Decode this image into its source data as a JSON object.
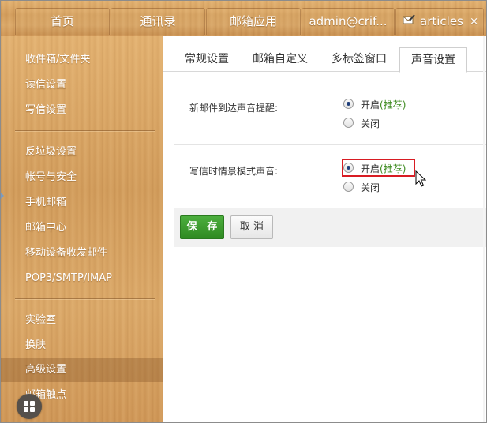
{
  "top_tabs": [
    {
      "label": "首页"
    },
    {
      "label": "通讯录"
    },
    {
      "label": "邮箱应用"
    },
    {
      "label": "admin@crif..."
    },
    {
      "label": "articles"
    }
  ],
  "top_tab_close": "×",
  "sidebar": {
    "groups": [
      [
        "收件箱/文件夹",
        "读信设置",
        "写信设置"
      ],
      [
        "反垃圾设置",
        "帐号与安全",
        "手机邮箱",
        "邮箱中心",
        "移动设备收发邮件",
        "POP3/SMTP/IMAP"
      ],
      [
        "实验室",
        "换肤",
        "高级设置",
        "邮箱触点"
      ]
    ],
    "active_item": "高级设置"
  },
  "sub_tabs": [
    {
      "label": "常规设置"
    },
    {
      "label": "邮箱自定义"
    },
    {
      "label": "多标签窗口"
    },
    {
      "label": "声音设置"
    }
  ],
  "active_sub_tab": "声音设置",
  "settings": [
    {
      "label": "新邮件到达声音提醒:",
      "options": [
        {
          "label": "开启",
          "note": "(推荐)",
          "selected": true
        },
        {
          "label": "关闭",
          "note": "",
          "selected": false
        }
      ]
    },
    {
      "label": "写信时情景模式声音:",
      "options": [
        {
          "label": "开启",
          "note": "(推荐)",
          "selected": true
        },
        {
          "label": "关闭",
          "note": "",
          "selected": false
        }
      ]
    }
  ],
  "buttons": {
    "save": "保 存",
    "cancel": "取 消"
  },
  "colors": {
    "recommend": "#3c8a1e",
    "save_button": "#3a9a2c",
    "highlight_box": "#d81c23"
  },
  "icons": {
    "compose_tab": "compose-icon",
    "apps_launcher": "grid-icon",
    "pointer": "cursor-icon"
  }
}
